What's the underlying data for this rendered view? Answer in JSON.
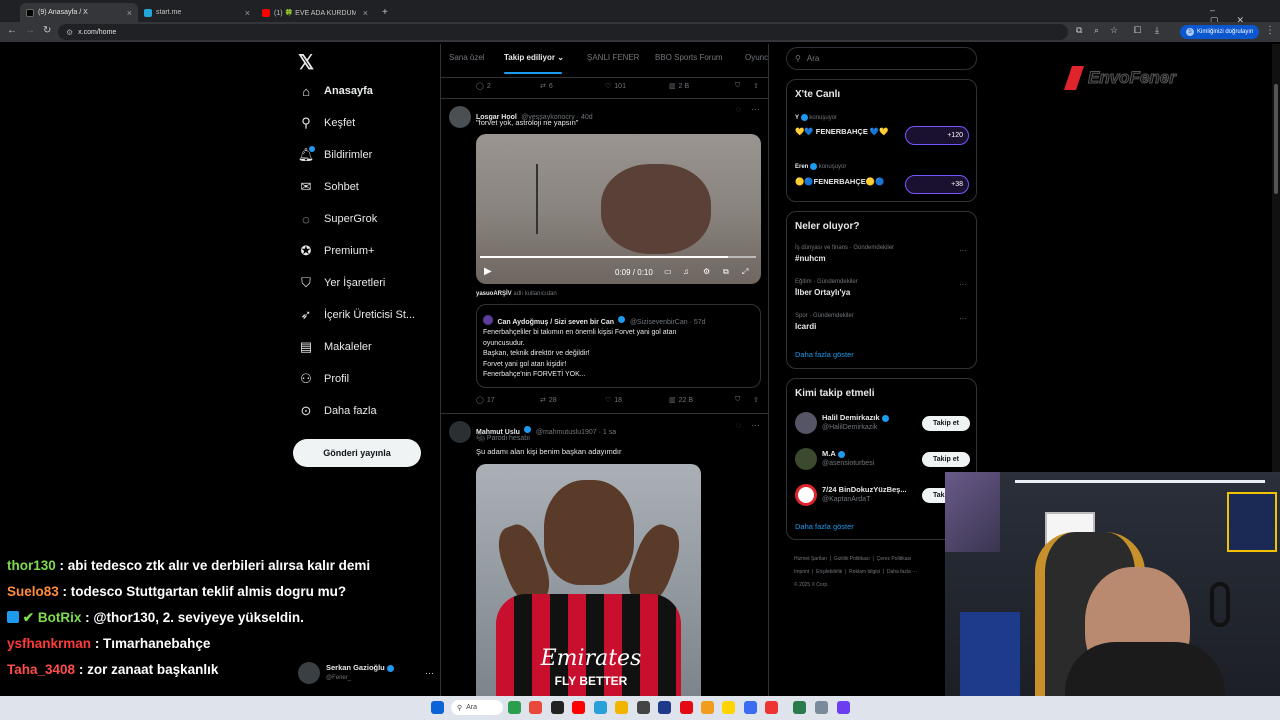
{
  "browser": {
    "tabs": [
      {
        "label": "(9) Anasayfa / X",
        "close": "×"
      },
      {
        "label": "start.me",
        "close": "×"
      },
      {
        "label": "(1) 🍀 EVE ADA KURDUM 💖 ...",
        "close": "×"
      }
    ],
    "new_tab": "+",
    "url": "x.com/home",
    "verify_label": "Kimliğinizi doğrulayın",
    "verify_initial": "S"
  },
  "nav": {
    "logo": "𝕏",
    "items": [
      "Anasayfa",
      "Keşfet",
      "Bildirimler",
      "Sohbet",
      "SuperGrok",
      "Premium+",
      "Yer İşaretleri",
      "İçerik Üreticisi St...",
      "Makaleler",
      "Profil",
      "Daha fazla"
    ],
    "post_button": "Gönderi yayınla",
    "account": {
      "name": "Serkan Gazioğlu",
      "handle": "@Fener_",
      "more": "···"
    }
  },
  "feed": {
    "tabs": [
      "Sana özel",
      "Takip ediliyor",
      "ŞANLI FENER",
      "BBO Sports Forum",
      "Oyunc"
    ],
    "top_actions": {
      "replies": "2",
      "reposts": "6",
      "likes": "101",
      "views": "2 B"
    },
    "tweet1": {
      "name": "Losgar Hool",
      "handle": "@yessaykonocry · 40d",
      "text": "\"forvet yok, astroloji ne yapsın\"",
      "video_time": "0:09 / 0:10",
      "source_name": "yasuoARŞİV",
      "source_suffix": "adlı kullanıcıdan",
      "quote": {
        "name": "Can Aydoğmuş / Sizi seven bir Can",
        "handle": "@SizisevenbirCan · 57d",
        "lines": [
          "Fenerbahçeliler bi takımın en önemli kişisi Forvet yani gol atan",
          "oyuncusudur.",
          "Başkan, teknik direktör ve değildir!",
          "Forvet yani gol atan kişidir!",
          "Fenerbahçe'nin FORVETİ YOK..."
        ]
      },
      "actions": {
        "replies": "17",
        "reposts": "28",
        "likes": "18",
        "views": "22 B"
      }
    },
    "tweet2": {
      "name": "Mahmut Uslu",
      "handle": "@mahmutuslu1907 · 1 sa",
      "label": "Parodi hesabı",
      "text": "Şu adamı alan kişi benim başkan adayımdır",
      "jersey_sponsor": "Emirates",
      "jersey_sub": "FLY BETTER"
    }
  },
  "sidebar": {
    "search_placeholder": "Ara",
    "live": {
      "title": "X'te Canlı",
      "items": [
        {
          "host": "Y",
          "status": "konuşuyor",
          "title": "💛💙 FENERBAHÇE 💙💛",
          "count": "+120"
        },
        {
          "host": "Eren",
          "status": "konuşuyor",
          "title": "🟡🔵FENERBAHÇE🟡🔵",
          "count": "+38"
        }
      ]
    },
    "trends": {
      "title": "Neler oluyor?",
      "items": [
        {
          "cat": "İş dünyası ve finans · Gündemdekiler",
          "name": "#nuhcm"
        },
        {
          "cat": "Eğitim · Gündemdekiler",
          "name": "İlber Ortaylı'ya"
        },
        {
          "cat": "Spor · Gündemdekiler",
          "name": "Icardi"
        }
      ],
      "more": "Daha fazla göster"
    },
    "follow": {
      "title": "Kimi takip etmeli",
      "items": [
        {
          "name": "Halil Demirkazık",
          "handle": "@HalilDemirkazik"
        },
        {
          "name": "M.A",
          "handle": "@asensioturbesi"
        },
        {
          "name": "7/24 BinDokuzYüzBeş...",
          "handle": "@KaptanArdaT"
        }
      ],
      "button": "Takip et",
      "more": "Daha fazla göster"
    },
    "footer": [
      "Hizmet Şartları",
      "Gizlilik Politikası",
      "Çerez Politikası",
      "Imprint",
      "Erişilebilirlik",
      "Reklam bilgisi",
      "Daha fazla ···",
      "© 2025 X Corp."
    ]
  },
  "overlay": {
    "brand": "EnvoFener",
    "chat": [
      {
        "user": "thor130",
        "msg": ": abi tedesco ztk alır ve derbileri alırsa kalır demi",
        "color": "#7ddc4f"
      },
      {
        "user": "Suelo83",
        "msg": ": todesco Stuttgartan teklif almis dogru mu?",
        "color": "#ff8c3a"
      },
      {
        "user": "BotRix",
        "msg": ": @thor130, 2. seviyeye yükseldin.",
        "color": "#7ddc4f"
      },
      {
        "user": "ysfhankrman",
        "msg": ": Tımarhanebahçe",
        "color": "#ff3a3a"
      },
      {
        "user": "Taha_3408",
        "msg": ": zor zanaat başkanlık",
        "color": "#ff4d4d"
      }
    ]
  },
  "taskbar": {
    "search": "Ara"
  },
  "colors": {
    "accent": "#1d9bf0",
    "bg": "#000000",
    "border": "#2f3336",
    "muted": "#71767b"
  }
}
